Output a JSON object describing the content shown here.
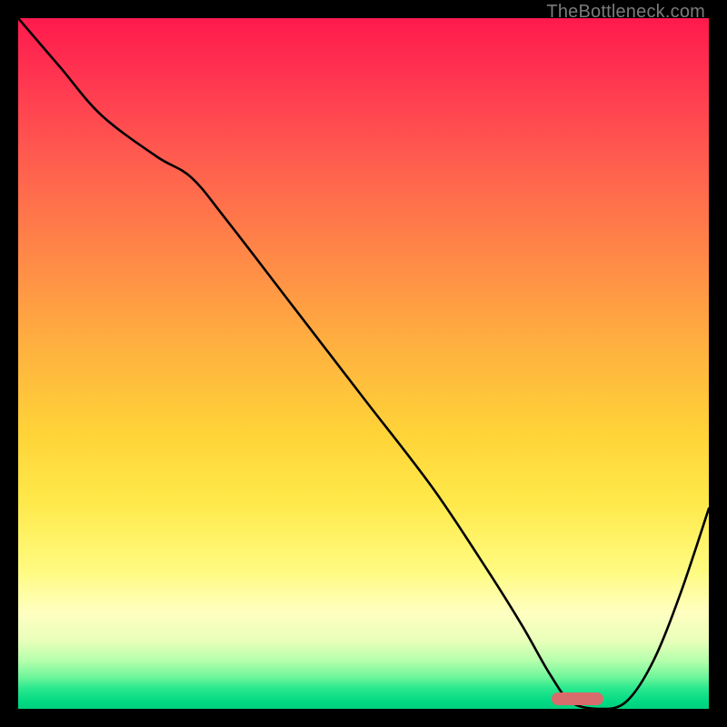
{
  "watermark": "TheBottleneck.com",
  "chart_data": {
    "type": "line",
    "title": "",
    "xlabel": "",
    "ylabel": "",
    "xlim": [
      0,
      100
    ],
    "ylim": [
      0,
      100
    ],
    "series": [
      {
        "name": "bottleneck-curve",
        "x": [
          0,
          6,
          12,
          20,
          25,
          30,
          40,
          50,
          60,
          68,
          73,
          77,
          80,
          84,
          88,
          92,
          96,
          100
        ],
        "values": [
          100,
          93,
          86,
          80,
          77,
          71,
          58,
          45,
          32,
          20,
          12,
          5,
          1,
          0,
          1,
          7,
          17,
          29
        ]
      }
    ],
    "optimum_marker": {
      "x_center_pct": 81,
      "y_pct": 1.5,
      "width_pct": 7.4
    },
    "background_gradient": {
      "top": "#ff1a4d",
      "mid": "#ffe94a",
      "bottom": "#00d07e"
    }
  }
}
